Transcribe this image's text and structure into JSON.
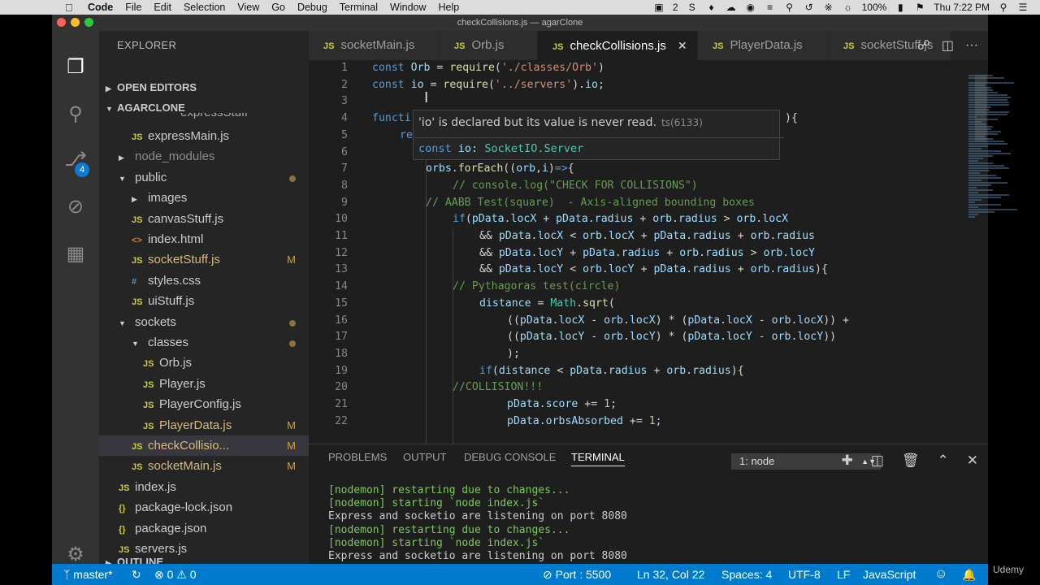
{
  "menubar": {
    "app_name": "Code",
    "items": [
      "File",
      "Edit",
      "Selection",
      "View",
      "Go",
      "Debug",
      "Terminal",
      "Window",
      "Help"
    ],
    "notif_count": "2",
    "battery": "100%",
    "clock": "Thu 7:22 PM"
  },
  "window": {
    "title": "checkCollisions.js — agarClone"
  },
  "activity_bar": {
    "scm_badge": "4"
  },
  "sidebar": {
    "title": "EXPLORER",
    "open_editors": "OPEN EDITORS",
    "project": "AGARCLONE",
    "outline": "OUTLINE",
    "partial_item": "expressStuff",
    "items": [
      {
        "label": "expressMain.js",
        "type": "js",
        "status": ""
      },
      {
        "label": "node_modules",
        "type": "folder",
        "status": ""
      },
      {
        "label": "public",
        "type": "folder",
        "status": "dot"
      },
      {
        "label": "images",
        "type": "folder",
        "status": ""
      },
      {
        "label": "canvasStuff.js",
        "type": "js",
        "status": ""
      },
      {
        "label": "index.html",
        "type": "html",
        "status": ""
      },
      {
        "label": "socketStuff.js",
        "type": "js",
        "status": "M"
      },
      {
        "label": "styles.css",
        "type": "css",
        "status": ""
      },
      {
        "label": "uiStuff.js",
        "type": "js",
        "status": ""
      },
      {
        "label": "sockets",
        "type": "folder",
        "status": "dot"
      },
      {
        "label": "classes",
        "type": "folder",
        "status": "dot"
      },
      {
        "label": "Orb.js",
        "type": "js",
        "status": ""
      },
      {
        "label": "Player.js",
        "type": "js",
        "status": ""
      },
      {
        "label": "PlayerConfig.js",
        "type": "js",
        "status": ""
      },
      {
        "label": "PlayerData.js",
        "type": "js",
        "status": "M"
      },
      {
        "label": "checkCollisio...",
        "type": "js",
        "status": "M"
      },
      {
        "label": "socketMain.js",
        "type": "js",
        "status": "M"
      },
      {
        "label": "index.js",
        "type": "js",
        "status": ""
      },
      {
        "label": "package-lock.json",
        "type": "json",
        "status": ""
      },
      {
        "label": "package.json",
        "type": "json",
        "status": ""
      },
      {
        "label": "servers.js",
        "type": "js",
        "status": ""
      }
    ]
  },
  "tabs": [
    {
      "label": "socketMain.js",
      "active": false
    },
    {
      "label": "Orb.js",
      "active": false
    },
    {
      "label": "checkCollisions.js",
      "active": true
    },
    {
      "label": "PlayerData.js",
      "active": false
    },
    {
      "label": "socketStuff.js",
      "active": false
    }
  ],
  "editor": {
    "js_icon_label": "JS",
    "close_glyph": "✕",
    "line_numbers": [
      "1",
      "2",
      "3",
      "4",
      "5",
      "6",
      "7",
      "8",
      "9",
      "10",
      "11",
      "12",
      "13",
      "14",
      "15",
      "16",
      "17",
      "18",
      "19",
      "20",
      "21",
      "22"
    ],
    "line5_prefix": "re",
    "line4_prefix": "functi",
    "line4_suffix": "){",
    "hover": {
      "message": "'io' is declared but its value is never read.",
      "code": "ts(6133)",
      "signature_kw": "const",
      "signature_name": "io:",
      "signature_type": "SocketIO.Server"
    }
  },
  "panel": {
    "tabs": [
      "PROBLEMS",
      "OUTPUT",
      "DEBUG CONSOLE",
      "TERMINAL"
    ],
    "terminal_select": "1: node",
    "terminal_lines": [
      "[nodemon] restarting due to changes...",
      "[nodemon] starting `node index.js`",
      "Express and socketio are listening on port 8080",
      "[nodemon] restarting due to changes...",
      "[nodemon] starting `node index.js`",
      "Express and socketio are listening on port 8080"
    ]
  },
  "statusbar": {
    "branch": "master*",
    "errors": "0",
    "warnings": "0",
    "port": "Port : 5500",
    "position": "Ln 32, Col 22",
    "spaces": "Spaces: 4",
    "encoding": "UTF-8",
    "eol": "LF",
    "language": "JavaScript"
  },
  "watermark": "Udemy",
  "colors": {
    "statusbar": "#007acc",
    "editor_bg": "#1e1e1e",
    "sidebar_bg": "#252526",
    "keyword": "#569cd6",
    "string": "#ce9178",
    "comment": "#6a9955",
    "terminal_green": "#7cc95a"
  }
}
